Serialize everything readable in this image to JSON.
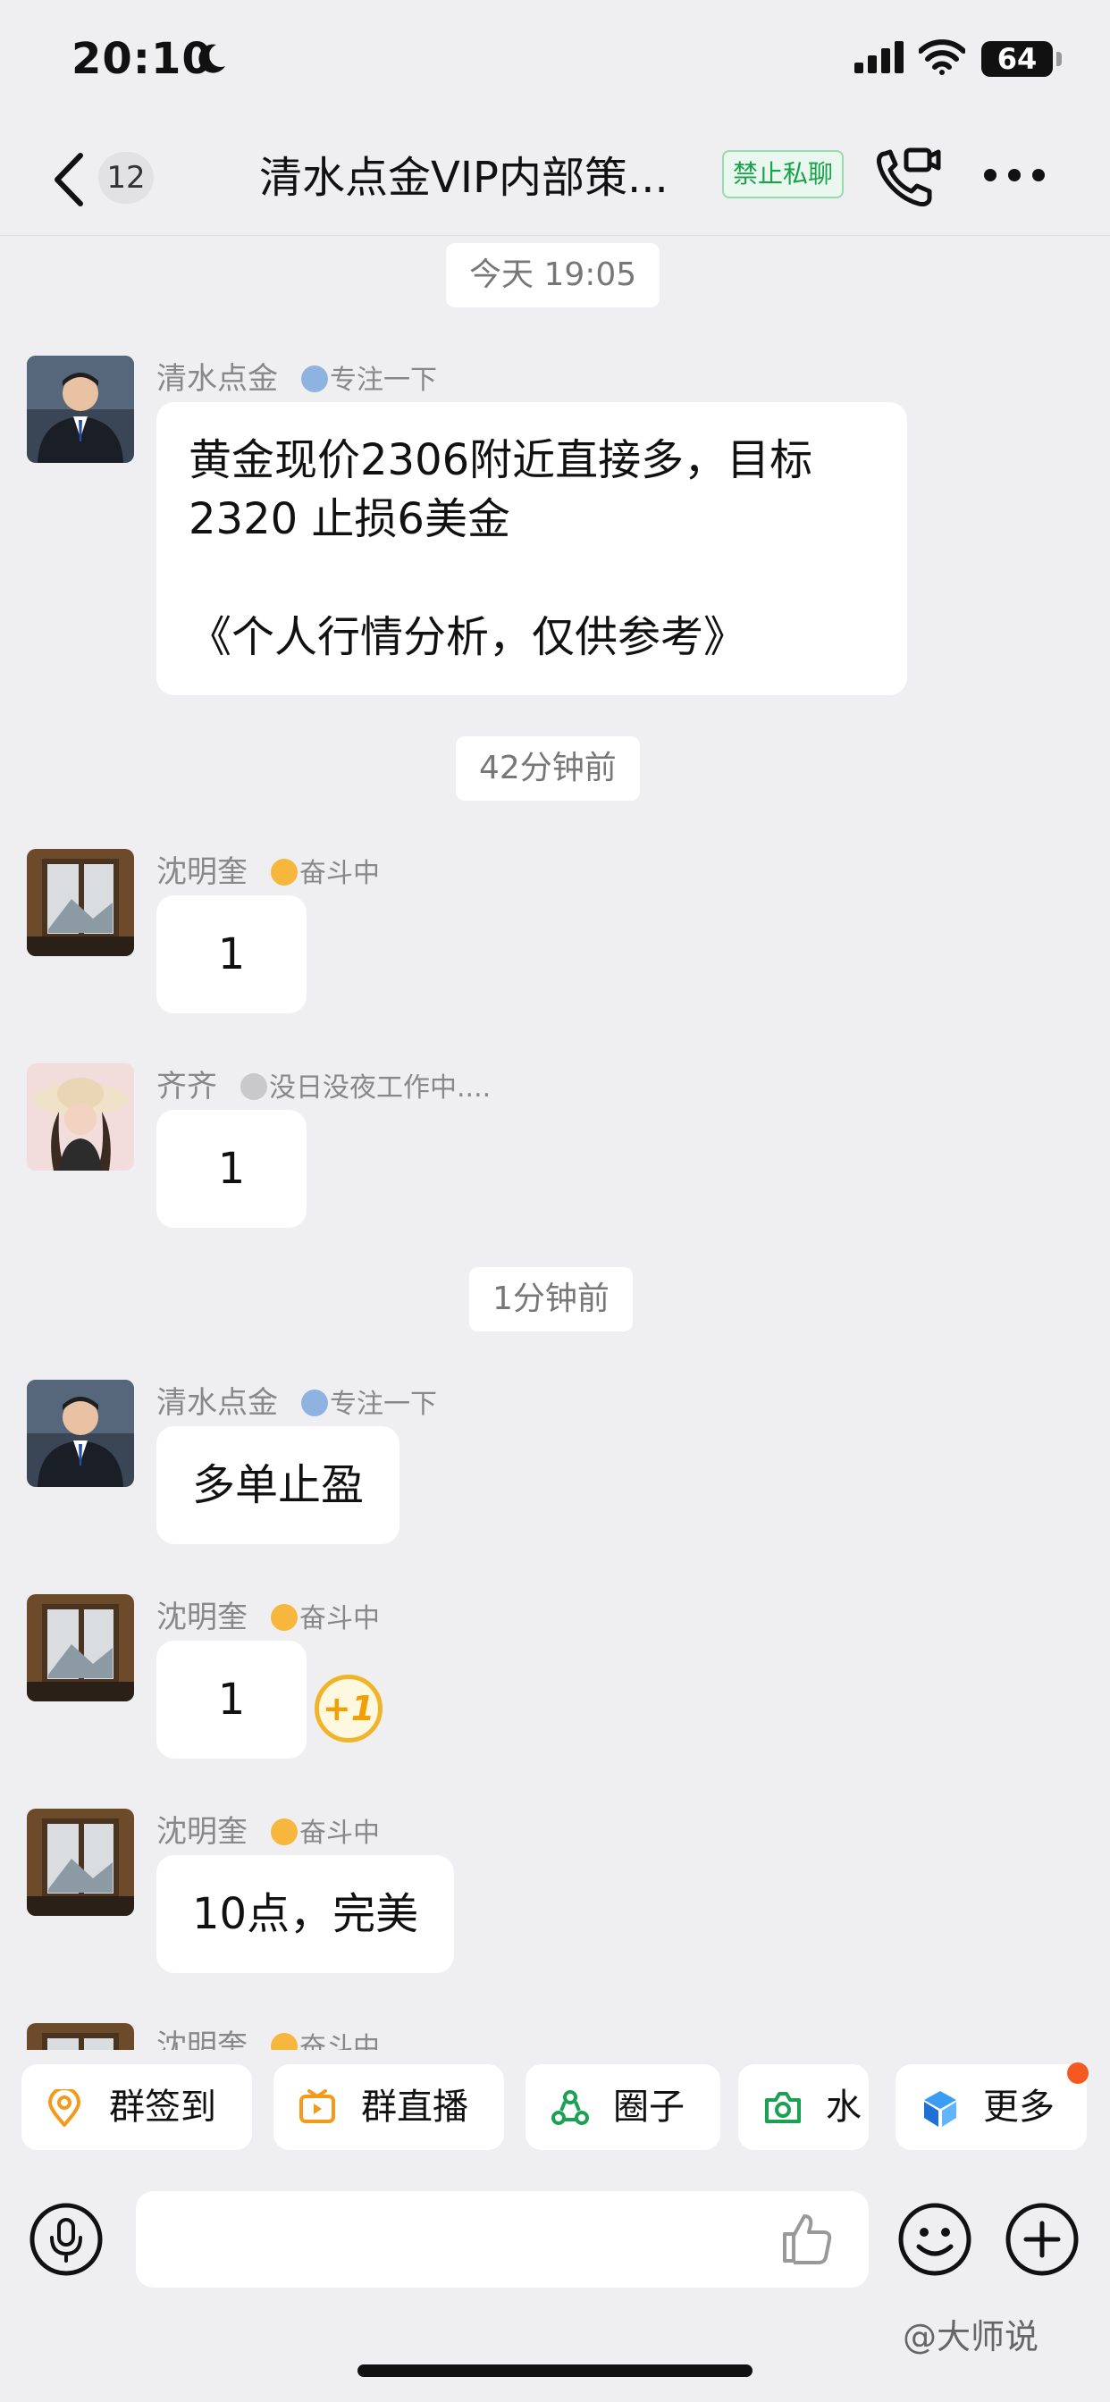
{
  "status_bar": {
    "time": "20:10",
    "battery": "64"
  },
  "header": {
    "unread_count": "12",
    "title": "清水点金VIP内部策...",
    "badge": "禁止私聊"
  },
  "messages": [
    {
      "type": "time",
      "text": "今天 19:05"
    },
    {
      "type": "message",
      "sender": "清水点金",
      "status": "专注一下",
      "lines": [
        "黄金现价2306附近直接多，目标",
        "2320 止损6美金",
        "",
        "《个人行情分析，仅供参考》"
      ]
    },
    {
      "type": "time",
      "text": "42分钟前"
    },
    {
      "type": "message",
      "sender": "沈明奎",
      "status": "奋斗中",
      "text": "1"
    },
    {
      "type": "message",
      "sender": "齐齐",
      "status": "没日没夜工作中....",
      "text": "1"
    },
    {
      "type": "time",
      "text": "1分钟前"
    },
    {
      "type": "message",
      "sender": "清水点金",
      "status": "专注一下",
      "text": "多单止盈"
    },
    {
      "type": "message",
      "sender": "沈明奎",
      "status": "奋斗中",
      "text": "1",
      "reaction": "+1"
    },
    {
      "type": "message",
      "sender": "沈明奎",
      "status": "奋斗中",
      "text": "10点，完美"
    },
    {
      "type": "message",
      "sender": "沈明奎",
      "status": "奋斗中",
      "text": ""
    }
  ],
  "quick_actions": [
    {
      "label": "群签到",
      "icon": "location-pin-icon"
    },
    {
      "label": "群直播",
      "icon": "tv-play-icon"
    },
    {
      "label": "圈子",
      "icon": "circle-group-icon"
    },
    {
      "label": "水",
      "icon": "camera-icon"
    },
    {
      "label": "更多",
      "icon": "cube-icon"
    }
  ],
  "input": {
    "placeholder": ""
  },
  "watermark": "@大师说",
  "colors": {
    "badge_green": "#16a34a",
    "notify_orange": "#f25a22",
    "background": "#efeff1"
  }
}
